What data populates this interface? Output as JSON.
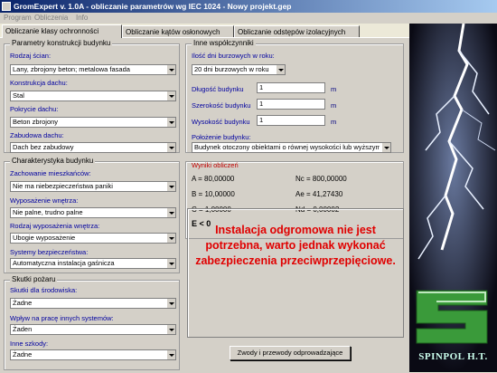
{
  "window": {
    "title": "GromExpert v. 1.0A - obliczanie parametrów wg IEC 1024 - Nowy projekt.gep"
  },
  "menu": [
    "Program",
    "Obliczenia",
    "Info"
  ],
  "tabs": [
    "Obliczanie klasy ochronności",
    "Obliczanie kątów osłonowych",
    "Obliczanie odstępów izolacyjnych"
  ],
  "building": {
    "title": "Parametry konstrukcji budynku",
    "walls_label": "Rodzaj ścian:",
    "walls": "Lany, zbrojony beton; metalowa fasada",
    "construction_label": "Konstrukcja dachu:",
    "construction": "Stal",
    "cover_label": "Pokrycie dachu:",
    "cover": "Beton zbrojony",
    "build_label": "Zabudowa dachu:",
    "build": "Dach bez zabudowy"
  },
  "other": {
    "title": "Inne współczynniki",
    "days_label": "Ilość dni burzowych w roku:",
    "days": "20 dni burzowych w roku",
    "length_label": "Długość budynku",
    "length": "1",
    "width_label": "Szerokość budynku",
    "width": "1",
    "height_label": "Wysokość budynku",
    "height": "1",
    "unit": "m",
    "position_label": "Położenie budynku:",
    "position": "Budynek otoczony obiektami o równej wysokości lub wyższymi"
  },
  "characteristics": {
    "title": "Charakterystyka budynku",
    "occupants_label": "Zachowanie mieszkańców:",
    "occupants": "Nie ma niebezpieczeństwa paniki",
    "interior_label": "Wyposażenie wnętrza:",
    "interior": "Nie palne, trudno palne",
    "interior_type_label": "Rodzaj wyposażenia wnętrza:",
    "interior_type": "Ubogie wyposażenie",
    "safety_label": "Systemy bezpieczeństwa:",
    "safety": "Automatyczna instalacja gaśnicza"
  },
  "fire": {
    "title": "Skutki pożaru",
    "env_label": "Skutki dla środowiska:",
    "env": "Żadne",
    "systems_label": "Wpływ na pracę innych systemów:",
    "systems": "Żaden",
    "other_label": "Inne szkody:",
    "other": "Żadne"
  },
  "results": {
    "title": "Wyniki obliczeń",
    "A": "A = 80,00000",
    "Nc": "Nc = 800,00000",
    "B": "B = 10,00000",
    "Ae": "Ae = 41,27430",
    "C": "C = 1,00000",
    "Nd": "Nd = 0,00002",
    "E": "E < 0"
  },
  "message": "Instalacja odgromowa nie jest potrzebna, warto jednak wykonać zabezpieczenia przeciwprzepięciowe.",
  "button_label": "Zwody i przewody odprowadzające",
  "brand": "SPINPOL H.T.",
  "colors": {
    "accent_red": "#e00000",
    "label_blue": "#0000a0",
    "title_bar": "#0a246a"
  }
}
